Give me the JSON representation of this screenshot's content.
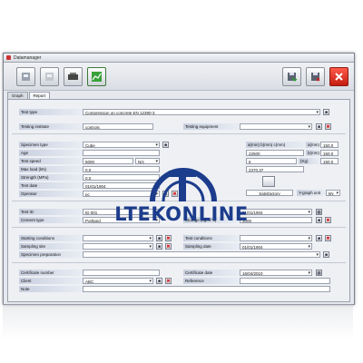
{
  "window": {
    "title": "Datamanager"
  },
  "toolbar": {
    "left_icons": [
      "lab-icon",
      "lab-disabled-icon",
      "test-press-icon",
      "chart-icon"
    ],
    "right_icons": [
      "save-disk-icon",
      "delete-disk-icon",
      "close-x-icon"
    ]
  },
  "tabs": [
    {
      "label": "Graph"
    },
    {
      "label": "Report"
    }
  ],
  "form": {
    "test_type": {
      "label": "Test type",
      "value": "Compression on concrete EN 12390-3"
    },
    "testing_institute": {
      "label": "Testing institute",
      "value": "controls"
    },
    "testing_equipment": {
      "label": "Testing equipment",
      "value": ""
    },
    "specimen_type": {
      "label": "Specimen type",
      "value": "Cube"
    },
    "age": {
      "label": "Age",
      "value": ""
    },
    "test_speed": {
      "label": "Test speed",
      "value": "5000",
      "unit": "N/s"
    },
    "max_load": {
      "label": "Max load (kN)",
      "value": "0.0"
    },
    "strength": {
      "label": "Strength (MPa)",
      "value": "0.0"
    },
    "test_date": {
      "label": "Test date",
      "value": "01/01/1904"
    },
    "operator": {
      "label": "Operator",
      "value": "pc"
    },
    "dims": {
      "label": "a(mm) b(mm) c(mm)",
      "unit": "a(mm)",
      "value": "150.0"
    },
    "dim_row2": {
      "value": "22500",
      "unit": "b(mm)",
      "value2": "150.0"
    },
    "dim_row3": {
      "value": "6",
      "unit": "(Kg)",
      "value2": "150.0"
    },
    "dim_row4": {
      "value": "2370.37"
    },
    "result": {
      "value": "Satisfactory"
    },
    "graph_unit": {
      "label": "Y-graph unit",
      "value": "kN"
    },
    "test_id": {
      "label": "Test ID",
      "value": "ID 001"
    },
    "cement_type": {
      "label": "Cement type",
      "value": "Portland"
    },
    "cast_date": {
      "value": "01/01/1904"
    },
    "storage": {
      "label": "Storage (kg/m^3)",
      "value": "3000"
    },
    "starting_conditions": {
      "label": "Starting conditions",
      "value": ""
    },
    "sampling_site": {
      "label": "Sampling site",
      "value": ""
    },
    "specimen_preparation": {
      "label": "Specimen preparation",
      "value": ""
    },
    "test_conditions": {
      "label": "Test conditions",
      "value": ""
    },
    "sampling_date": {
      "label": "Sampling date",
      "value": "01/01/1904"
    },
    "certificate_number": {
      "label": "Certificate number",
      "value": ""
    },
    "client": {
      "label": "Client",
      "value": "ABC"
    },
    "note": {
      "label": "Note",
      "value": ""
    },
    "certificate_date": {
      "label": "Certificate date",
      "value": "16/04/2010"
    },
    "reference": {
      "label": "Reference",
      "value": ""
    }
  },
  "watermark": {
    "text": "LTEKONLINE"
  },
  "colors": {
    "label_bg": "#c9d1e0",
    "accent_red": "#cc2222",
    "watermark_blue": "#1c3c8c"
  }
}
